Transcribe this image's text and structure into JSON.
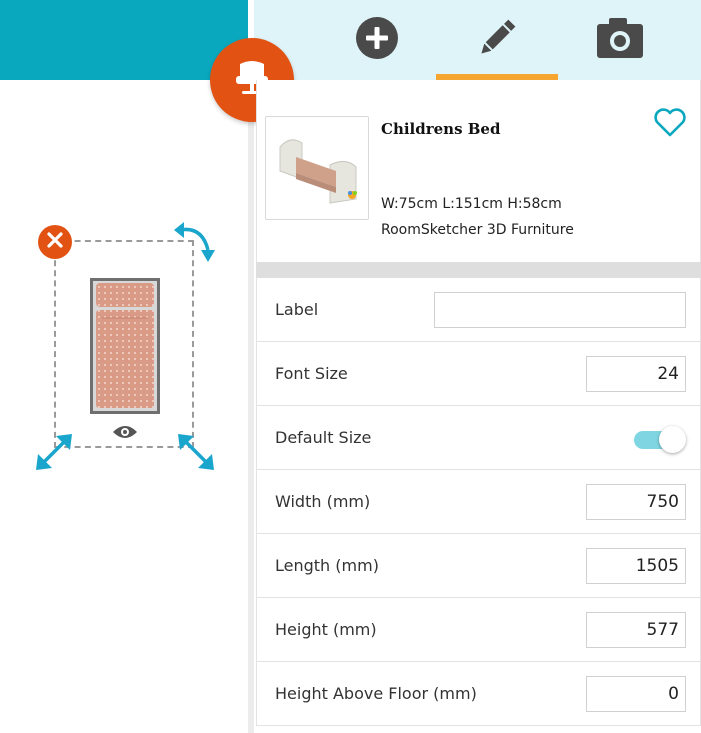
{
  "tabs": [
    {
      "name": "add",
      "icon": "plus-circle-icon"
    },
    {
      "name": "edit",
      "icon": "pencil-icon",
      "active": true
    },
    {
      "name": "camera",
      "icon": "camera-icon"
    }
  ],
  "item": {
    "name": "Childrens Bed",
    "dimensions": "W:75cm L:151cm H:58cm",
    "source": "RoomSketcher 3D Furniture",
    "favorite_icon": "heart-outline-icon"
  },
  "properties": {
    "label": {
      "label": "Label",
      "value": ""
    },
    "font_size": {
      "label": "Font Size",
      "value": "24"
    },
    "default_size": {
      "label": "Default Size",
      "checked": true
    },
    "width": {
      "label": "Width (mm)",
      "value": "750"
    },
    "length": {
      "label": "Length (mm)",
      "value": "1505"
    },
    "height": {
      "label": "Height (mm)",
      "value": "577"
    },
    "height_above_floor": {
      "label": "Height Above Floor (mm)",
      "value": "0"
    }
  },
  "colors": {
    "accent_teal": "#0aa8be",
    "tab_bg": "#dff4f8",
    "active_tab_underline": "#f6a531",
    "brand_orange": "#e25313",
    "toggle_on": "#7fd6e2"
  }
}
